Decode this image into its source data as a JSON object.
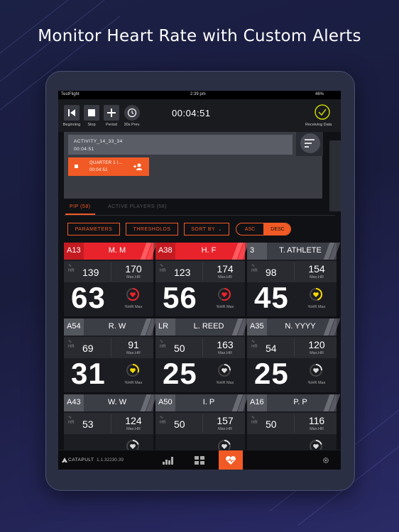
{
  "headline": "Monitor Heart Rate with Custom Alerts",
  "status_bar": {
    "carrier": "TestFlight",
    "time": "2:39 pm",
    "battery": "46%"
  },
  "controls": [
    {
      "label": "Beginning",
      "icon": "skip-back-icon"
    },
    {
      "label": "Stop",
      "icon": "stop-icon"
    },
    {
      "label": "Period",
      "icon": "plus-icon"
    },
    {
      "label": "30s Prev.",
      "icon": "clock-back-icon"
    }
  ],
  "timer": "00:04:51",
  "receiving": {
    "label": "Receiving Data",
    "icon": "check-circle-icon"
  },
  "activity": {
    "name": "ACTIVITY_14_33_34",
    "time": "00:04:51"
  },
  "quarter": {
    "name": "QUARTER 1 I...",
    "time": "00:04:51"
  },
  "tabs": {
    "pip": "PIP (58)",
    "active": "ACTIVE PLAYERS (58)"
  },
  "filters": {
    "parameters": "PARAMETERS",
    "thresholds": "THRESHOLDS",
    "sort_by": "SORT BY",
    "asc": "ASC",
    "desc": "DESC"
  },
  "players": [
    {
      "tag": "A13",
      "name": "M. M",
      "alert": true,
      "hr": "139",
      "max_hr": "170",
      "pct": "63",
      "pct_fraction": 0.63,
      "gauge_color": "#e8232b"
    },
    {
      "tag": "A38",
      "name": "H. F",
      "alert": true,
      "hr": "123",
      "max_hr": "174",
      "pct": "56",
      "pct_fraction": 0.56,
      "gauge_color": "#e8232b"
    },
    {
      "tag": "3",
      "name": "T. ATHLETE",
      "alert": false,
      "hr": "98",
      "max_hr": "154",
      "pct": "45",
      "pct_fraction": 0.45,
      "gauge_color": "#f5d800"
    },
    {
      "tag": "A54",
      "name": "R. W",
      "alert": false,
      "hr": "69",
      "max_hr": "91",
      "pct": "31",
      "pct_fraction": 0.31,
      "gauge_color": "#f5d800"
    },
    {
      "tag": "LR",
      "name": "L. REED",
      "alert": false,
      "hr": "50",
      "max_hr": "163",
      "pct": "25",
      "pct_fraction": 0.25,
      "gauge_color": "#dddddd"
    },
    {
      "tag": "A35",
      "name": "N. YYYY",
      "alert": false,
      "hr": "54",
      "max_hr": "120",
      "pct": "25",
      "pct_fraction": 0.25,
      "gauge_color": "#dddddd"
    },
    {
      "tag": "A43",
      "name": "W. W",
      "alert": false,
      "hr": "53",
      "max_hr": "124",
      "pct": "",
      "pct_fraction": 0.2,
      "gauge_color": "#dddddd"
    },
    {
      "tag": "A50",
      "name": "I. P",
      "alert": false,
      "hr": "50",
      "max_hr": "157",
      "pct": "",
      "pct_fraction": 0.2,
      "gauge_color": "#dddddd"
    },
    {
      "tag": "A16",
      "name": "P. P",
      "alert": false,
      "hr": "50",
      "max_hr": "116",
      "pct": "",
      "pct_fraction": 0.2,
      "gauge_color": "#dddddd"
    }
  ],
  "labels": {
    "hr": "HR",
    "max_hr": "Max.HR",
    "pct_hr_max": "%HR Max"
  },
  "footer": {
    "brand": "CATAPULT",
    "version": "1.1.32230.39"
  },
  "accent": "#f15a24",
  "alert_color": "#e8232b"
}
